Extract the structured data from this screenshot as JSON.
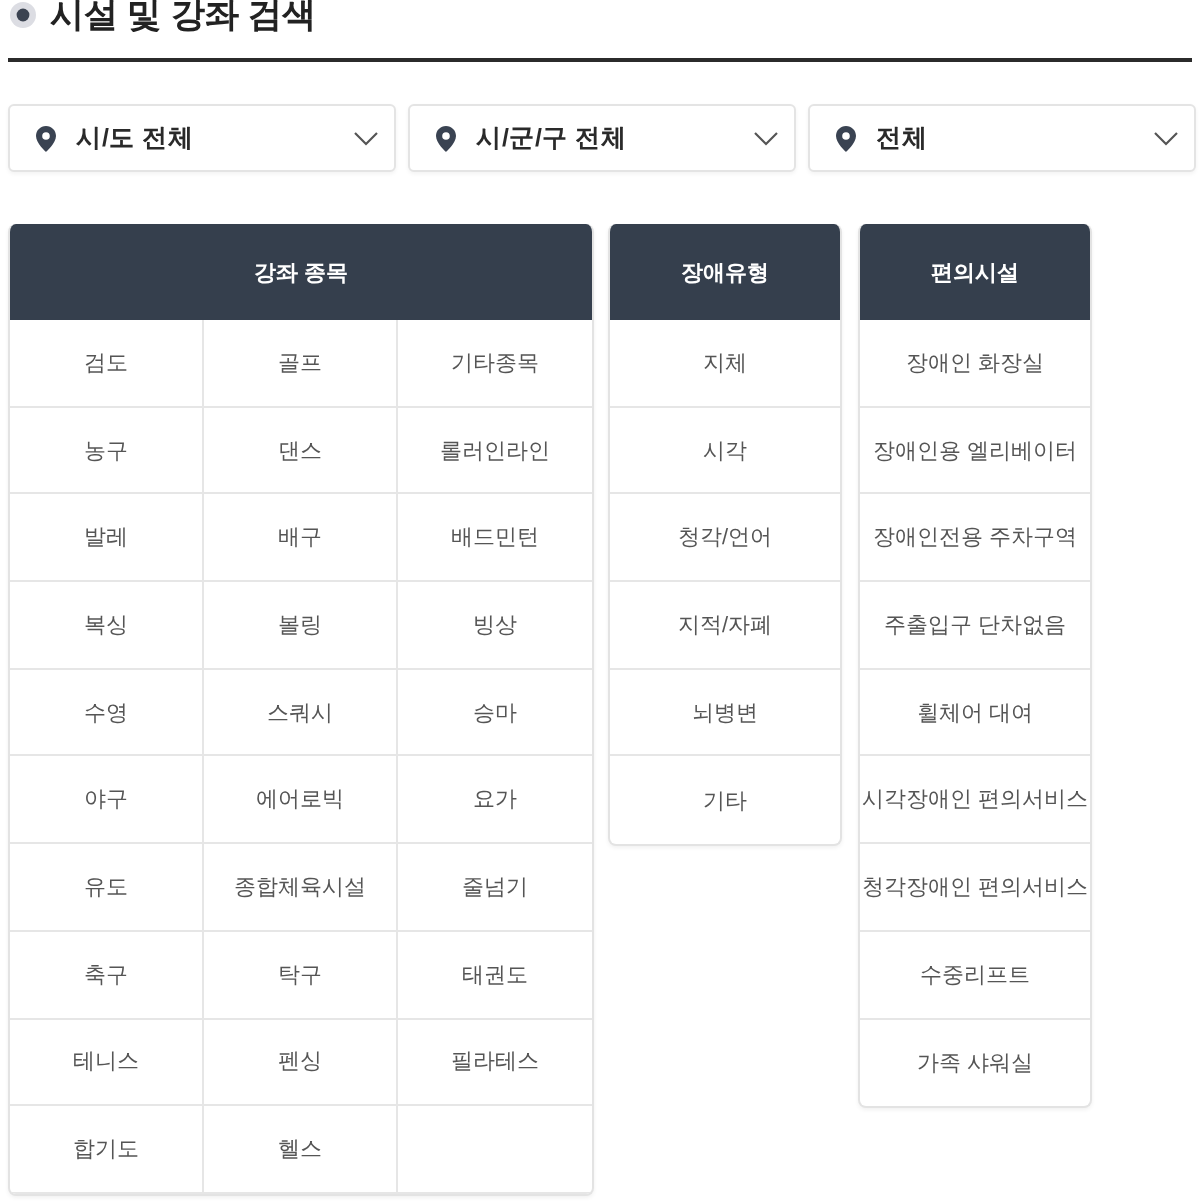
{
  "page": {
    "title": "시설 및 강좌 검색"
  },
  "filters": [
    {
      "value": "시/도 전체"
    },
    {
      "value": "시/군/구 전체"
    },
    {
      "value": "전체"
    }
  ],
  "panels": [
    {
      "kind": "grid",
      "heading": "강좌 종목",
      "items": [
        "검도",
        "골프",
        "기타종목",
        "농구",
        "댄스",
        "롤러인라인",
        "발레",
        "배구",
        "배드민턴",
        "복싱",
        "볼링",
        "빙상",
        "수영",
        "스쿼시",
        "승마",
        "야구",
        "에어로빅",
        "요가",
        "유도",
        "종합체육시설",
        "줄넘기",
        "축구",
        "탁구",
        "태권도",
        "테니스",
        "펜싱",
        "필라테스",
        "합기도",
        "헬스"
      ]
    },
    {
      "kind": "list",
      "heading": "장애유형",
      "items": [
        "지체",
        "시각",
        "청각/언어",
        "지적/자폐",
        "뇌병변",
        "기타"
      ]
    },
    {
      "kind": "list",
      "heading": "편의시설",
      "items": [
        "장애인 화장실",
        "장애인용 엘리베이터",
        "장애인전용 주차구역",
        "주출입구 단차없음",
        "휠체어 대여",
        "시각장애인 편의서비스",
        "청각장애인 편의서비스",
        "수중리프트",
        "가족 샤워실"
      ]
    }
  ]
}
